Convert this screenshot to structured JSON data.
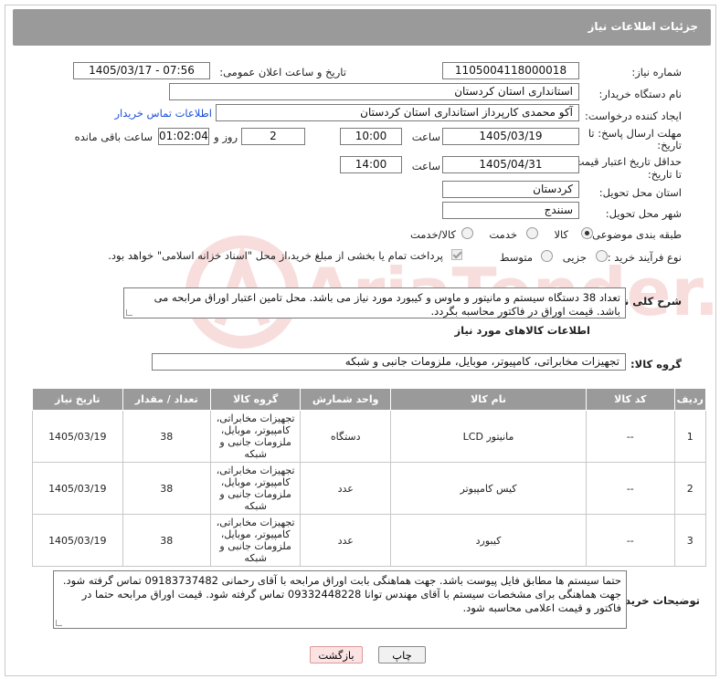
{
  "header": {
    "title": "جزئیات اطلاعات نیاز"
  },
  "fields": {
    "need_number_label": "شماره نیاز:",
    "need_number": "1105004118000018",
    "announce_label": "تاریخ و ساعت اعلان عمومی:",
    "announce_value": "1405/03/17 - 07:56",
    "buyer_org_label": "نام دستگاه خریدار:",
    "buyer_org": "استانداری استان کردستان",
    "creator_label": "ایجاد کننده درخواست:",
    "creator": "آکو محمدی کارپرداز استانداری استان کردستان",
    "buyer_contact_link": "اطلاعات تماس خریدار",
    "deadline_label_1": "مهلت ارسال پاسخ: تا",
    "deadline_label_2": "تاریخ:",
    "deadline_date": "1405/03/19",
    "time_label": "ساعت",
    "deadline_time": "10:00",
    "days_value": "2",
    "days_label": "روز و",
    "remaining_time": "01:02:04",
    "remaining_label": "ساعت باقی مانده",
    "validity_label_1": "حداقل تاریخ اعتبار قیمت:",
    "validity_label_2": "تا تاریخ:",
    "validity_date": "1405/04/31",
    "validity_time": "14:00",
    "province_label": "استان محل تحویل:",
    "province": "کردستان",
    "city_label": "شهر محل تحویل:",
    "city": "سنندج",
    "category_label": "طبقه بندی موضوعی:",
    "category_options": [
      "کالا",
      "خدمت",
      "کالا/خدمت"
    ],
    "category_selected": "کالا",
    "process_label": "نوع فرآیند خرید :",
    "process_options": [
      "جزیی",
      "متوسط"
    ],
    "payment_note": "پرداخت تمام یا بخشی از مبلغ خرید،از محل \"اسناد خزانه اسلامی\" خواهد بود.",
    "description_label": "شرح کلی نیاز:",
    "description": "تعداد 38 دستگاه سیستم و مانیتور و ماوس و کیبورد مورد نیاز می باشد. محل تامین اعتبار اوراق مرابحه می باشد. قیمت اوراق در فاکتور محاسبه بگردد.",
    "goods_info_title": "اطلاعات کالاهای مورد نیاز",
    "goods_group_label": "گروه کالا:",
    "goods_group": "تجهیزات مخابراتی، کامپیوتر، موبایل، ملزومات جانبی و شبکه"
  },
  "table": {
    "headers": [
      "ردیف",
      "کد کالا",
      "نام کالا",
      "واحد شمارش",
      "گروه کالا",
      "تعداد / مقدار",
      "تاریخ نیاز"
    ],
    "rows": [
      [
        "1",
        "--",
        "مانیتور LCD",
        "دستگاه",
        "تجهیزات مخابراتی، کامپیوتر، موبایل، ملزومات جانبی و شبکه",
        "38",
        "1405/03/19"
      ],
      [
        "2",
        "--",
        "کیس کامپیوتر",
        "عدد",
        "تجهیزات مخابراتی، کامپیوتر، موبایل، ملزومات جانبی و شبکه",
        "38",
        "1405/03/19"
      ],
      [
        "3",
        "--",
        "کیبورد",
        "عدد",
        "تجهیزات مخابراتی، کامپیوتر، موبایل، ملزومات جانبی و شبکه",
        "38",
        "1405/03/19"
      ]
    ]
  },
  "notes": {
    "label": "توضیحات خریدار:",
    "text": "حتما سیستم ها مطابق فایل پیوست باشد. جهت هماهنگی بابت اوراق مرابحه با آقای رحمانی 09183737482 تماس گرفته شود. جهت هماهنگی برای مشخصات سیستم با آقای مهندس توانا 09332448228 تماس گرفته شود. قیمت اوراق مرابحه حتما در فاکتور و قیمت اعلامی محاسبه شود."
  },
  "buttons": {
    "print": "چاپ",
    "back": "بازگشت"
  },
  "watermark": "AriaTender.net"
}
